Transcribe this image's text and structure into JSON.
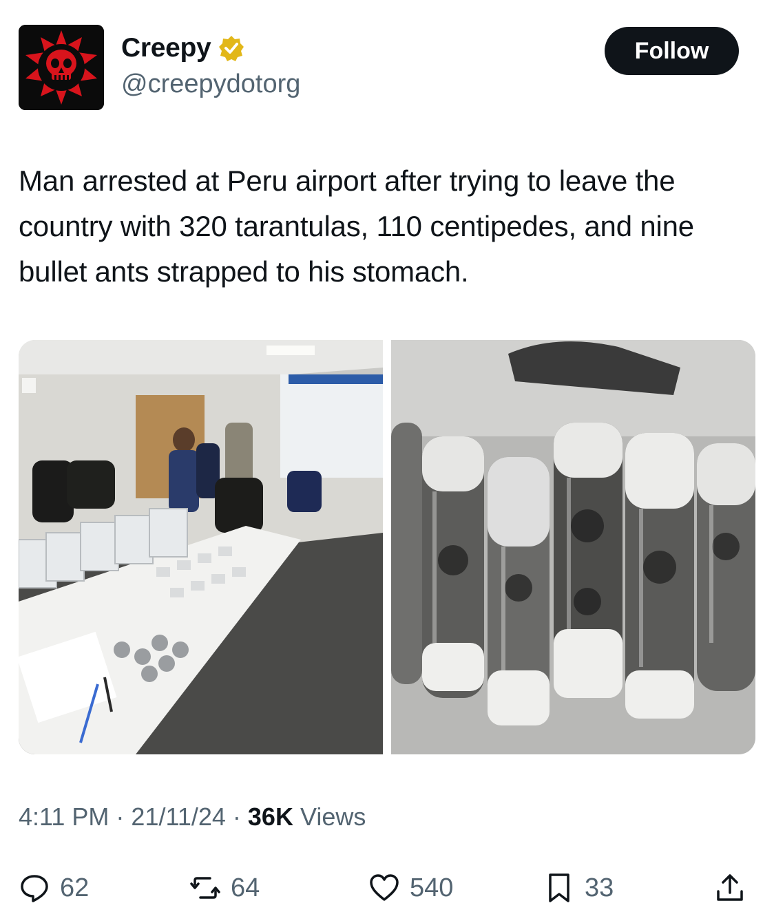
{
  "author": {
    "name": "Creepy",
    "handle": "@creepydotorg",
    "verified": true
  },
  "follow_label": "Follow",
  "tweet_text": "Man arrested at Peru airport after trying to leave the country with 320 tarantulas, 110 centipedes, and nine bullet ants strapped to his stomach.",
  "meta": {
    "time": "4:11 PM",
    "date": "21/11/24",
    "views_count": "36K",
    "views_label": "Views"
  },
  "actions": {
    "replies": "62",
    "reposts": "64",
    "likes": "540",
    "bookmarks": "33"
  },
  "colors": {
    "text": "#0f1419",
    "secondary": "#536471",
    "verified_gold": "#e2b719",
    "avatar_red": "#d8141c"
  },
  "icons": [
    "verified-badge-icon",
    "reply-icon",
    "repost-icon",
    "like-icon",
    "bookmark-icon",
    "share-icon"
  ]
}
